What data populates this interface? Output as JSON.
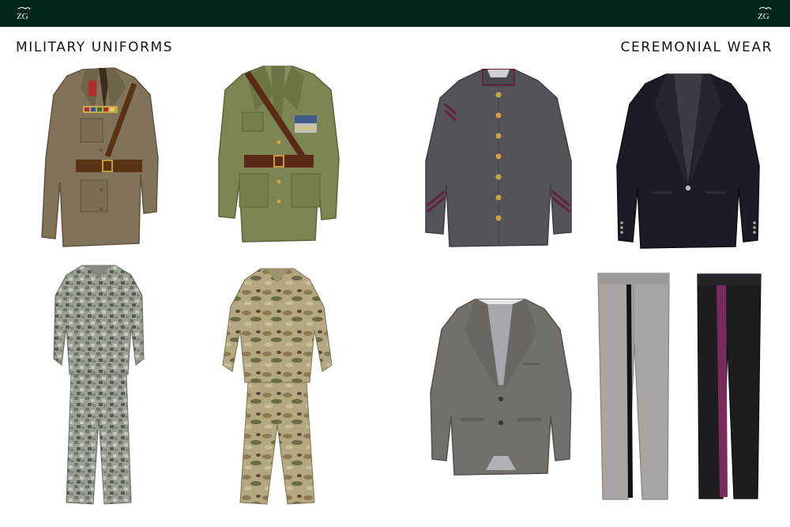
{
  "header": {
    "logo_text": "ZG",
    "background_color": "#05261a"
  },
  "sections": {
    "military": {
      "title": "MILITARY UNIFORMS"
    },
    "ceremonial": {
      "title": "CEREMONIAL WEAR"
    }
  },
  "garments": [
    {
      "section": "military",
      "item": "khaki field service jacket with medals and Sam Browne belt",
      "color": "#80735a"
    },
    {
      "section": "military",
      "item": "olive dress jacket with medals and cross-strap belt",
      "color": "#7d8553"
    },
    {
      "section": "military",
      "item": "digital camouflage combat uniform",
      "color": "#8e948a"
    },
    {
      "section": "military",
      "item": "multicam combat uniform",
      "color": "#a2956c"
    },
    {
      "section": "ceremonial",
      "item": "grey tunic with maroon trim and gold buttons",
      "color": "#55535a"
    },
    {
      "section": "ceremonial",
      "item": "black single-breasted blazer",
      "color": "#1c1c26"
    },
    {
      "section": "ceremonial",
      "item": "grey tweed sports jacket",
      "color": "#736f6b"
    },
    {
      "section": "ceremonial",
      "item": "grey trousers with black side stripe",
      "color": "#a8a5a3"
    },
    {
      "section": "ceremonial",
      "item": "black trousers with maroon side stripe",
      "color": "#1d1c1f"
    }
  ]
}
